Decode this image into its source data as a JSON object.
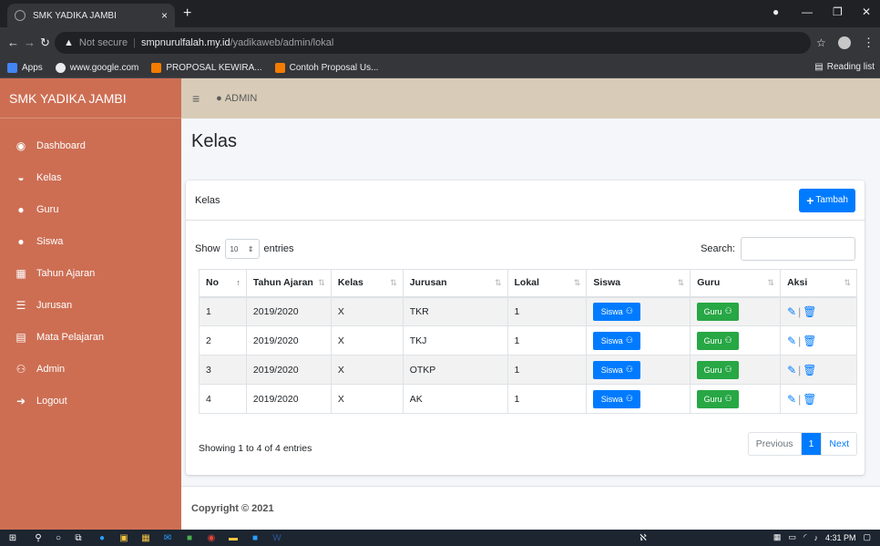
{
  "browser": {
    "tab_title": "SMK YADIKA JAMBI",
    "tab_close": "×",
    "new_tab": "+",
    "not_secure": "Not secure",
    "url_host": "smpnurulfalah.my.id",
    "url_path": "/yadikaweb/admin/lokal",
    "bookmarks": [
      "Apps",
      "www.google.com",
      "PROPOSAL KEWIRA...",
      "Contoh Proposal Us..."
    ],
    "reading_list": "Reading list"
  },
  "sidebar": {
    "brand": "SMK YADIKA JAMBI",
    "items": [
      {
        "label": "Dashboard",
        "icon": "dashboard-icon"
      },
      {
        "label": "Kelas",
        "icon": "hdd-icon"
      },
      {
        "label": "Guru",
        "icon": "user-icon"
      },
      {
        "label": "Siswa",
        "icon": "user-icon"
      },
      {
        "label": "Tahun Ajaran",
        "icon": "calendar-icon"
      },
      {
        "label": "Jurusan",
        "icon": "list-icon"
      },
      {
        "label": "Mata Pelajaran",
        "icon": "file-icon"
      },
      {
        "label": "Admin",
        "icon": "users-icon"
      },
      {
        "label": "Logout",
        "icon": "sign-out-icon"
      }
    ]
  },
  "topnav": {
    "user": "ADMIN"
  },
  "page": {
    "title": "Kelas",
    "card_title": "Kelas",
    "add_button": "Tambah",
    "show_label": "Show",
    "entries_value": "10",
    "entries_label": "entries",
    "search_label": "Search:",
    "search_value": "",
    "info": "Showing 1 to 4 of 4 entries",
    "pager": {
      "previous": "Previous",
      "page": "1",
      "next": "Next"
    },
    "footer": "Copyright © 2021"
  },
  "table": {
    "headers": [
      "No",
      "Tahun Ajaran",
      "Kelas",
      "Jurusan",
      "Lokal",
      "Siswa",
      "Guru",
      "Aksi"
    ],
    "siswa_button": "Siswa",
    "guru_button": "Guru",
    "rows": [
      {
        "no": "1",
        "tahun": "2019/2020",
        "kelas": "X",
        "jurusan": "TKR",
        "lokal": "1"
      },
      {
        "no": "2",
        "tahun": "2019/2020",
        "kelas": "X",
        "jurusan": "TKJ",
        "lokal": "1"
      },
      {
        "no": "3",
        "tahun": "2019/2020",
        "kelas": "X",
        "jurusan": "OTKP",
        "lokal": "1"
      },
      {
        "no": "4",
        "tahun": "2019/2020",
        "kelas": "X",
        "jurusan": "AK",
        "lokal": "1"
      }
    ]
  },
  "taskbar": {
    "time": "4:31 PM"
  },
  "colors": {
    "sidebar": "#cd6e53",
    "topbar": "#d8ccb8",
    "primary": "#007bff",
    "success": "#28a745"
  }
}
